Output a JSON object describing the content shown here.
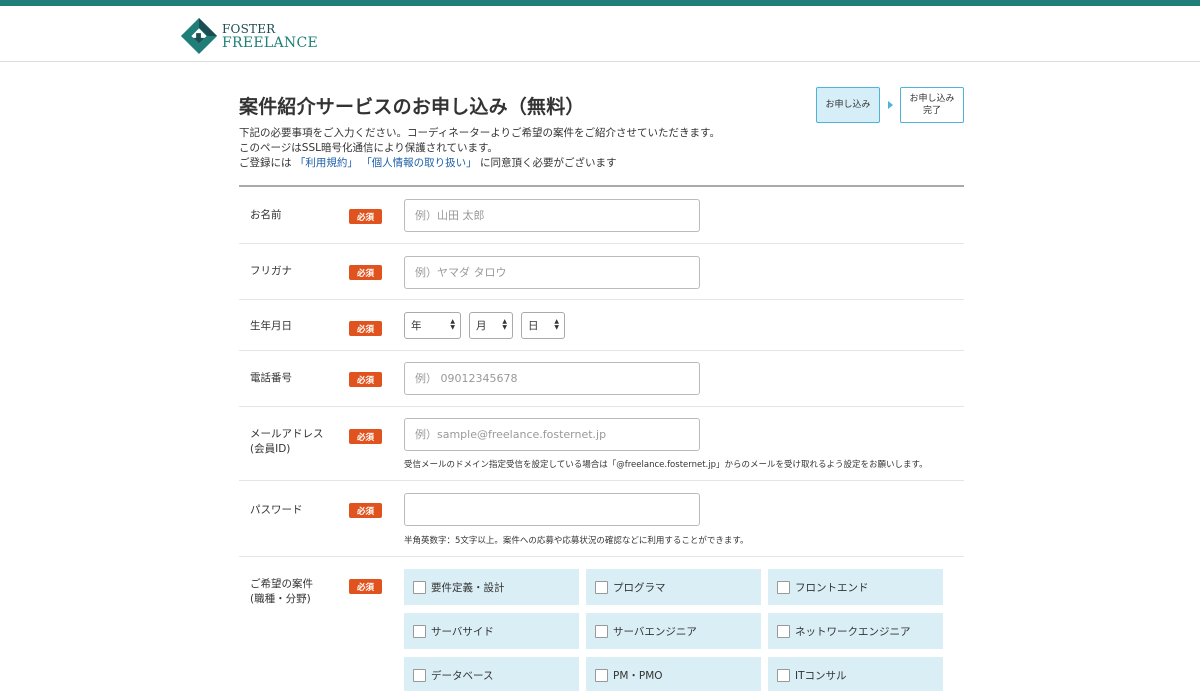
{
  "header": {
    "logo_line1": "FOSTER",
    "logo_line2": "FREELANCE",
    "brand_color": "#1f7f78"
  },
  "page": {
    "title": "案件紹介サービスのお申し込み（無料）",
    "intro_line1": "下記の必要事項をご入力ください。コーディネーターよりご希望の案件をご紹介させていただきます。",
    "intro_line2": "このページはSSL暗号化通信により保護されています。",
    "intro_line3_prefix": "ご登録には",
    "terms_link": "「利用規約」",
    "privacy_link": "「個人情報の取り扱い」",
    "intro_line3_suffix": "に同意頂く必要がございます"
  },
  "steps": [
    {
      "label": "お申し込み",
      "active": true
    },
    {
      "label_line1": "お申し込み",
      "label_line2": "完了",
      "active": false
    }
  ],
  "form": {
    "required_badge": "必須",
    "name": {
      "label": "お名前",
      "placeholder": "例）山田 太郎"
    },
    "furigana": {
      "label": "フリガナ",
      "placeholder": "例）ヤマダ タロウ"
    },
    "birthdate": {
      "label": "生年月日",
      "year": "年",
      "month": "月",
      "day": "日"
    },
    "phone": {
      "label": "電話番号",
      "placeholder": "例） 09012345678"
    },
    "email": {
      "label_line1": "メールアドレス",
      "label_line2": "(会員ID)",
      "placeholder": "例）sample@freelance.fosternet.jp",
      "note": "受信メールのドメイン指定受信を設定している場合は「@freelance.fosternet.jp」からのメールを受け取れるよう設定をお願いします。"
    },
    "password": {
      "label": "パスワード",
      "note": "半角英数字：5文字以上。案件への応募や応募状況の確認などに利用することができます。"
    },
    "jobs": {
      "label_line1": "ご希望の案件",
      "label_line2": "(職種・分野)",
      "options": [
        "要件定義・設計",
        "プログラマ",
        "フロントエンド",
        "サーバサイド",
        "サーバエンジニア",
        "ネットワークエンジニア",
        "データベース",
        "PM・PMO",
        "ITコンサル"
      ]
    }
  },
  "colors": {
    "required": "#e0531f",
    "link": "#1e5fa8",
    "step_border": "#4fb3d9",
    "checkbox_bg": "#daeef6"
  }
}
